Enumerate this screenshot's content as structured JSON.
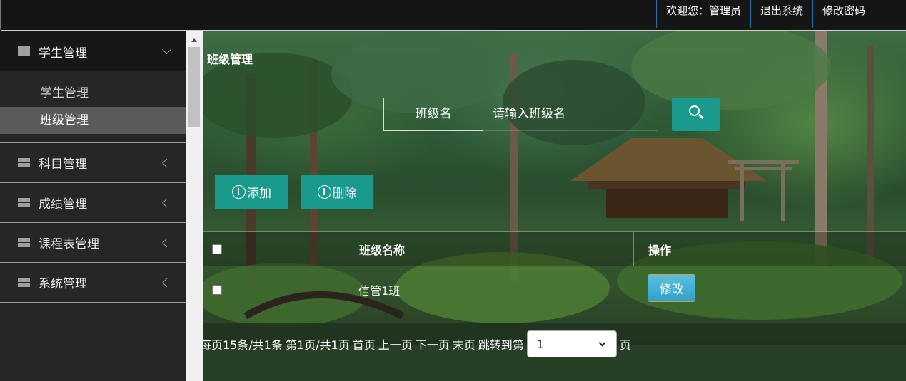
{
  "topbar": {
    "welcome": "欢迎您：管理员",
    "logout": "退出系统",
    "change_password": "修改密码"
  },
  "sidebar": {
    "menus": [
      {
        "label": "学生管理",
        "icon": "grid-icon",
        "expanded": true,
        "items": [
          {
            "label": "学生管理"
          },
          {
            "label": "班级管理",
            "active": true
          }
        ]
      },
      {
        "label": "科目管理",
        "icon": "grid-icon"
      },
      {
        "label": "成绩管理",
        "icon": "grid-icon"
      },
      {
        "label": "课程表管理",
        "icon": "grid-icon"
      },
      {
        "label": "系统管理",
        "icon": "grid-icon"
      }
    ]
  },
  "main": {
    "title": "班级管理",
    "search": {
      "label": "班级名",
      "placeholder": "请输入班级名",
      "button_icon": "search-icon"
    },
    "add_label": "添加",
    "delete_label": "删除",
    "table": {
      "columns": [
        "班级名称",
        "操作"
      ],
      "rows": [
        {
          "name": "信管1班",
          "action": "修改"
        }
      ]
    },
    "pager": {
      "summary": "每页15条/共1条",
      "page_info": "第1页/共1页",
      "first": "首页",
      "prev": "上一页",
      "next": "下一页",
      "last": "末页",
      "jump_label": "跳转到第",
      "current_page": "1",
      "suffix": "页"
    }
  },
  "colors": {
    "accent": "#1a9a8c",
    "edit_button": "#3fb0d6",
    "sidebar_bg": "#262626",
    "topbar_bg": "#151515"
  }
}
